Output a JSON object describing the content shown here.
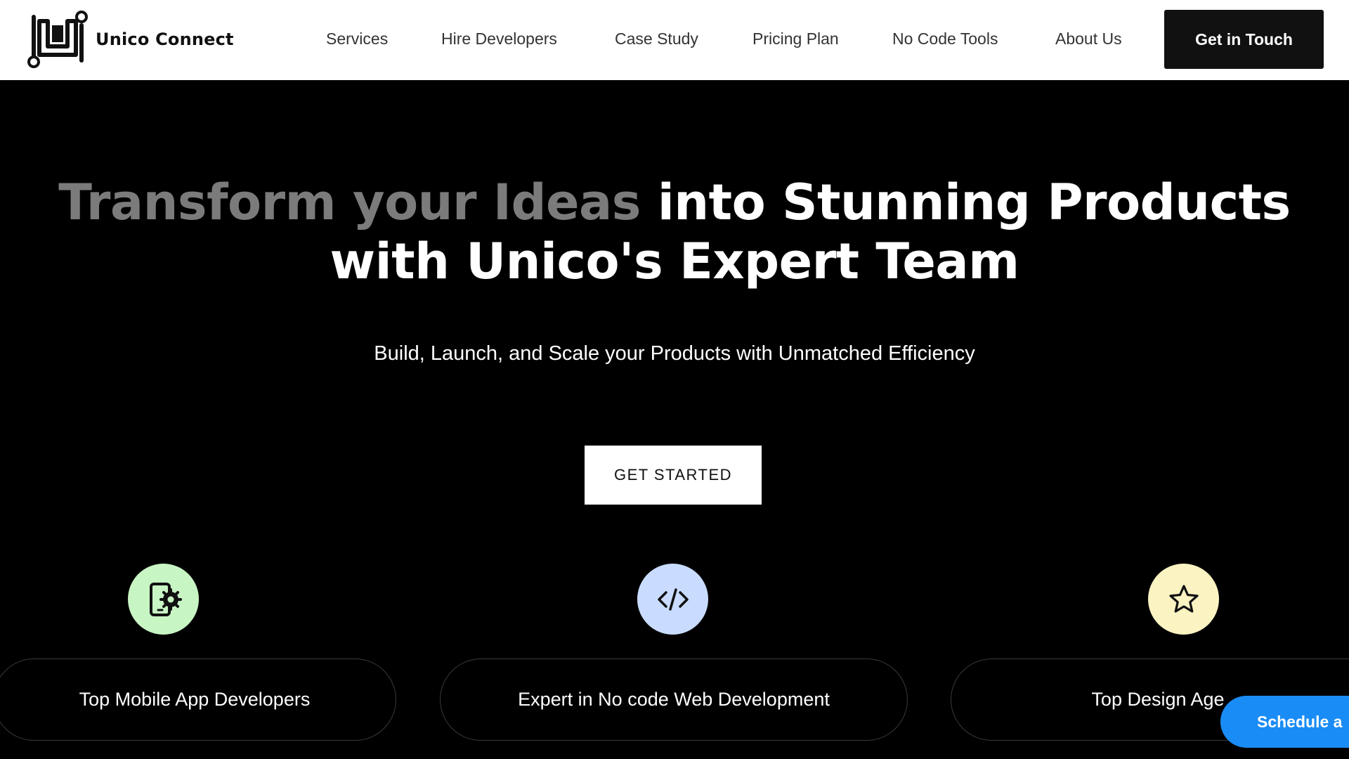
{
  "brand": {
    "name": "Unico Connect",
    "logo_icon": "unico-u-logo-icon"
  },
  "nav": {
    "items": [
      {
        "label": "Services"
      },
      {
        "label": "Hire Developers"
      },
      {
        "label": "Case Study"
      },
      {
        "label": "Pricing Plan"
      },
      {
        "label": "No Code Tools"
      },
      {
        "label": "About Us"
      }
    ],
    "cta_label": "Get in Touch"
  },
  "hero": {
    "title_muted": "Transform your Ideas",
    "title_bright_line1": "into Stunning Products",
    "title_line2": "with Unico's Expert Team",
    "subtitle": "Build, Launch, and Scale your Products with Unmatched Efficiency",
    "button_label": "GET STARTED"
  },
  "features": [
    {
      "label": "Top Mobile App Developers",
      "icon": "mobile-settings-icon",
      "icon_bg": "#c8f5c4"
    },
    {
      "label": "Expert in No code Web Development",
      "icon": "code-icon",
      "icon_bg": "#c9dcff"
    },
    {
      "label": "Top Design Age",
      "icon": "star-icon",
      "icon_bg": "#fbf3c2"
    }
  ],
  "floating": {
    "schedule_label": "Schedule a"
  },
  "colors": {
    "background": "#000000",
    "header": "#ffffff",
    "accent_blue": "#1a8cf5",
    "muted_text": "#7b7b7b"
  }
}
